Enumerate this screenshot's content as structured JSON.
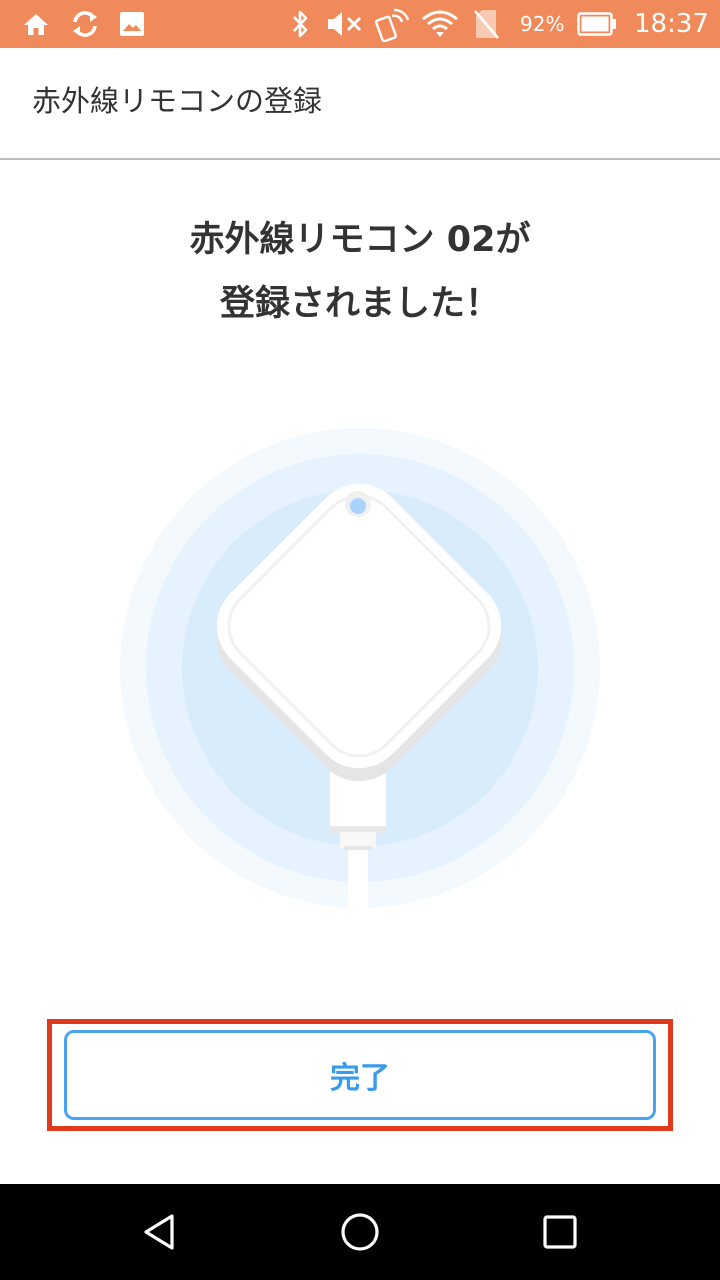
{
  "status_bar": {
    "icons": [
      "home-icon",
      "sync-icon",
      "image-icon",
      "bluetooth-icon",
      "mute-icon",
      "nfc-icon",
      "wifi-icon",
      "no-sim-icon",
      "battery-icon"
    ],
    "battery": "92%",
    "time": "18:37",
    "color": "#f08a5a"
  },
  "app_bar": {
    "title": "赤外線リモコンの登録"
  },
  "message": {
    "line1": "赤外線リモコン 02が",
    "line2": "登録されました！"
  },
  "illustration": {
    "icon": "ir-remote-device-icon"
  },
  "done_button": {
    "label": "完了",
    "color": "#3a9bea",
    "highlight_color": "#e03a1e"
  },
  "nav_bar": {
    "icons": [
      "back-icon",
      "home-circle-icon",
      "recents-icon"
    ]
  }
}
